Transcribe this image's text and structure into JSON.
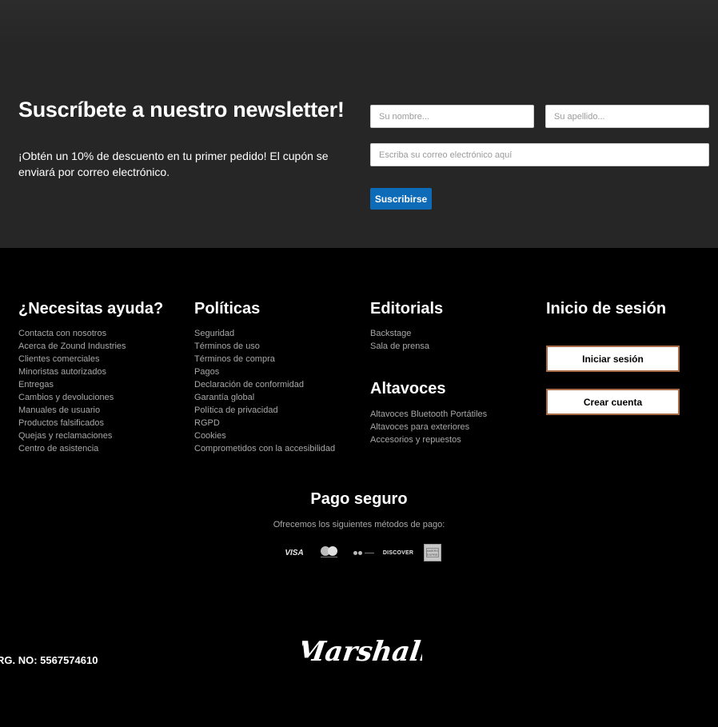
{
  "newsletter": {
    "title": "Suscríbete a nuestro newsletter!",
    "description": "¡Obtén un 10% de descuento en tu primer pedido! El cupón se enviará por correo electrónico.",
    "first_name_placeholder": "Su nombre...",
    "last_name_placeholder": "Su apellido...",
    "email_placeholder": "Escriba su correo electrónico aquí",
    "subscribe_label": "Suscribirse"
  },
  "help": {
    "title": "¿Necesitas ayuda?",
    "links": [
      "Contacta con nosotros",
      "Acerca de Zound Industries",
      "Clientes comerciales",
      "Minoristas autorizados",
      "Entregas",
      "Cambios y devoluciones",
      "Manuales de usuario",
      "Productos falsificados",
      "Quejas y reclamaciones",
      "Centro de asistencia"
    ]
  },
  "policies": {
    "title": "Políticas",
    "links": [
      "Seguridad",
      "Términos de uso",
      "Términos de compra",
      "Pagos",
      "Declaración de conformidad",
      "Garantía global",
      "Política de privacidad",
      "RGPD",
      "Cookies",
      "Comprometidos con la accesibilidad"
    ]
  },
  "editorials": {
    "title": "Editorials",
    "links": [
      "Backstage",
      "Sala de prensa"
    ]
  },
  "speakers": {
    "title": "Altavoces",
    "links": [
      "Altavoces Bluetooth Portátiles",
      "Altavoces para exteriores",
      "Accesorios y repuestos"
    ]
  },
  "login": {
    "title": "Inicio de sesión",
    "signin_label": "Iniciar sesión",
    "create_label": "Crear cuenta"
  },
  "payment": {
    "title": "Pago seguro",
    "subtitle": "Ofrecemos los siguientes métodos de pago:",
    "visa_text": "VISA",
    "discover_text": "DISCOVER",
    "amex_text": "AMERICAN EXPRESS",
    "icons": [
      "visa-icon",
      "mastercard-icon",
      "maestro-icon",
      "discover-icon",
      "amex-icon"
    ]
  },
  "footer": {
    "reg_number": "RG. NO: 5567574610",
    "brand": "Marshall"
  }
}
